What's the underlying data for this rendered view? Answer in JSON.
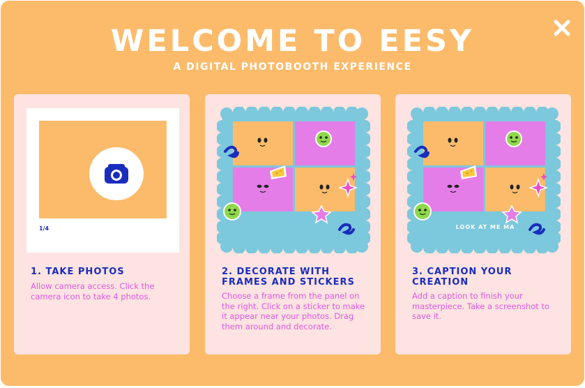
{
  "header": {
    "title": "WELCOME TO EESY",
    "subtitle": "A DIGITAL PHOTOBOOTH EXPERIENCE"
  },
  "close_icon": "close-icon",
  "colors": {
    "background": "#fcbb6b",
    "card": "#fde3e1",
    "title": "#1a2dbd",
    "desc": "#de59e0",
    "frame_blue": "#7cc8dc",
    "pink_cell": "#e47de8",
    "orange_cell": "#fcbb6b"
  },
  "steps": [
    {
      "title": "1. TAKE PHOTOS",
      "description": "Allow camera access. Click the camera icon to take 4 photos.",
      "preview": {
        "counter": "1/4",
        "icon": "camera-icon"
      }
    },
    {
      "title": "2. DECORATE WITH FRAMES AND STICKERS",
      "description": "Choose a frame from the panel on the right. Click on a sticker to make it appear near your photos. Drag them around and decorate."
    },
    {
      "title": "3. CAPTION YOUR CREATION",
      "description": "Add a caption to finish your masterpiece. Take a screenshot to save it.",
      "preview": {
        "caption": "LOOK AT ME MA"
      }
    }
  ]
}
